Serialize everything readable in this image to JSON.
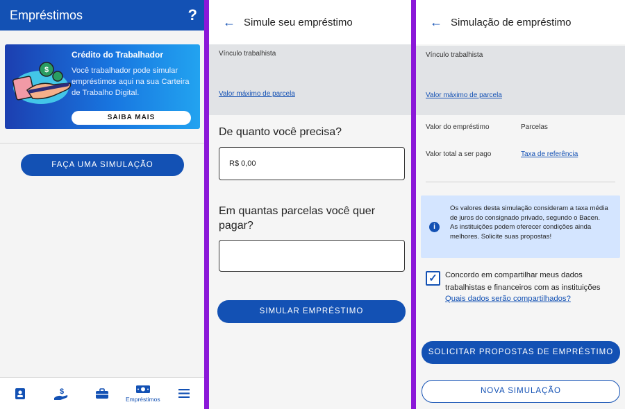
{
  "screen1": {
    "title": "Empréstimos",
    "help_icon": "?",
    "banner": {
      "title": "Crédito do Trabalhador",
      "text": "Você trabalhador pode simular empréstimos aqui na sua Carteira de Trabalho Digital.",
      "button": "SAIBA MAIS"
    },
    "simulate_button": "FAÇA UMA SIMULAÇÃO",
    "bottom_nav": [
      {
        "icon": "id-card-icon",
        "label": ""
      },
      {
        "icon": "hand-money-icon",
        "label": ""
      },
      {
        "icon": "briefcase-icon",
        "label": ""
      },
      {
        "icon": "banknote-icon",
        "label": "Empréstimos"
      },
      {
        "icon": "menu-icon",
        "label": ""
      }
    ]
  },
  "screen2": {
    "title": "Simule seu empréstimo",
    "vinculo_label": "Vínculo trabalhista",
    "valor_max_link": "Valor máximo de parcela",
    "question_amount": "De quanto você precisa?",
    "amount_value": "R$ 0,00",
    "question_installments": "Em quantas parcelas você quer pagar?",
    "installments_value": "",
    "submit_button": "SIMULAR EMPRÉSTIMO"
  },
  "screen3": {
    "title": "Simulação de empréstimo",
    "vinculo_label": "Vínculo trabalhista",
    "valor_max_link": "Valor máximo de parcela",
    "valor_emprestimo_label": "Valor do empréstimo",
    "parcelas_label": "Parcelas",
    "valor_total_label": "Valor total a ser pago",
    "taxa_link": "Taxa de referência",
    "info_text": "Os valores desta simulação consideram a taxa média de juros do consignado privado, segundo o Bacen. As instituições podem oferecer condições ainda melhores. Solicite suas propostas!",
    "consent_checked": true,
    "consent_text": "Concordo em compartilhar meus dados trabalhistas e financeiros com as instituições",
    "consent_link": "Quais dados serão compartilhados?",
    "request_button": "SOLICITAR PROPOSTAS DE EMPRÉSTIMO",
    "new_sim_button": "NOVA SIMULAÇÃO"
  },
  "colors": {
    "primary": "#1351b4",
    "separator": "#8b18d8",
    "info_bg": "#d4e5ff",
    "gray_block": "#e1e3e6"
  }
}
